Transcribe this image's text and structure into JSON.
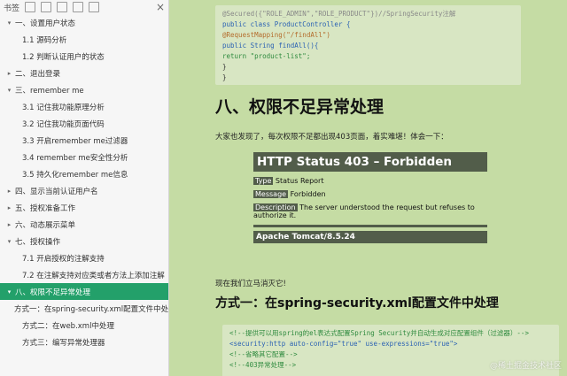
{
  "sidebar": {
    "toolbar_title": "书签",
    "close": "×",
    "items": [
      {
        "label": "一、设置用户状态",
        "expander": "▾",
        "level": 1
      },
      {
        "label": "1.1 源码分析",
        "expander": "",
        "level": 2
      },
      {
        "label": "1.2 判断认证用户的状态",
        "expander": "",
        "level": 2
      },
      {
        "label": "二、退出登录",
        "expander": "▸",
        "level": 1
      },
      {
        "label": "三、remember me",
        "expander": "▾",
        "level": 1
      },
      {
        "label": "3.1 记住我功能原理分析",
        "expander": "",
        "level": 2
      },
      {
        "label": "3.2 记住我功能页面代码",
        "expander": "",
        "level": 2
      },
      {
        "label": "3.3 开启remember me过滤器",
        "expander": "",
        "level": 2
      },
      {
        "label": "3.4 remember me安全性分析",
        "expander": "",
        "level": 2
      },
      {
        "label": "3.5 持久化remember me信息",
        "expander": "",
        "level": 2
      },
      {
        "label": "四、显示当前认证用户名",
        "expander": "▸",
        "level": 1
      },
      {
        "label": "五、授权准备工作",
        "expander": "▸",
        "level": 1
      },
      {
        "label": "六、动态展示菜单",
        "expander": "▸",
        "level": 1
      },
      {
        "label": "七、授权操作",
        "expander": "▾",
        "level": 1
      },
      {
        "label": "7.1 开启授权的注解支持",
        "expander": "",
        "level": 2
      },
      {
        "label": "7.2 在注解支持对应类或者方法上添加注解",
        "expander": "",
        "level": 2
      },
      {
        "label": "八、权限不足异常处理",
        "expander": "▾",
        "level": 1,
        "active": true
      },
      {
        "label": "方式一：在spring-security.xml配置文件中处理",
        "expander": "",
        "level": 2
      },
      {
        "label": "方式二：在web.xml中处理",
        "expander": "",
        "level": 2
      },
      {
        "label": "方式三：编写异常处理器",
        "expander": "",
        "level": 2
      }
    ]
  },
  "content": {
    "code1": [
      "@Secured({\"ROLE_ADMIN\",\"ROLE_PRODUCT\"})//SpringSecurity注解",
      "public class ProductController {",
      "    @RequestMapping(\"/findAll\")",
      "    public String findAll(){",
      "        return \"product-list\";",
      "    }",
      "}"
    ],
    "heading": "八、权限不足异常处理",
    "intro": "大家也发现了，每次权限不足都出现403页面，着实难堪！体会一下：",
    "tomcat": {
      "title": "HTTP Status 403 – Forbidden",
      "type_label": "Type",
      "type_value": "Status Report",
      "message_label": "Message",
      "message_value": "Forbidden",
      "desc_label": "Description",
      "desc_value": "The server understood the request but refuses to authorize it.",
      "footer": "Apache Tomcat/8.5.24"
    },
    "after": "现在我们立马消灭它!",
    "subheading": "方式一：在spring-security.xml配置文件中处理",
    "code2": [
      "<!--提供可以用spring的el表达式配置Spring Security并自动生成对应配置组件（过滤器）-->",
      "<security:http auto-config=\"true\" use-expressions=\"true\">",
      "    <!--省略其它配置-->",
      "    <!--403异常处理-->"
    ],
    "watermark": "@稀土掘金技术社区"
  }
}
